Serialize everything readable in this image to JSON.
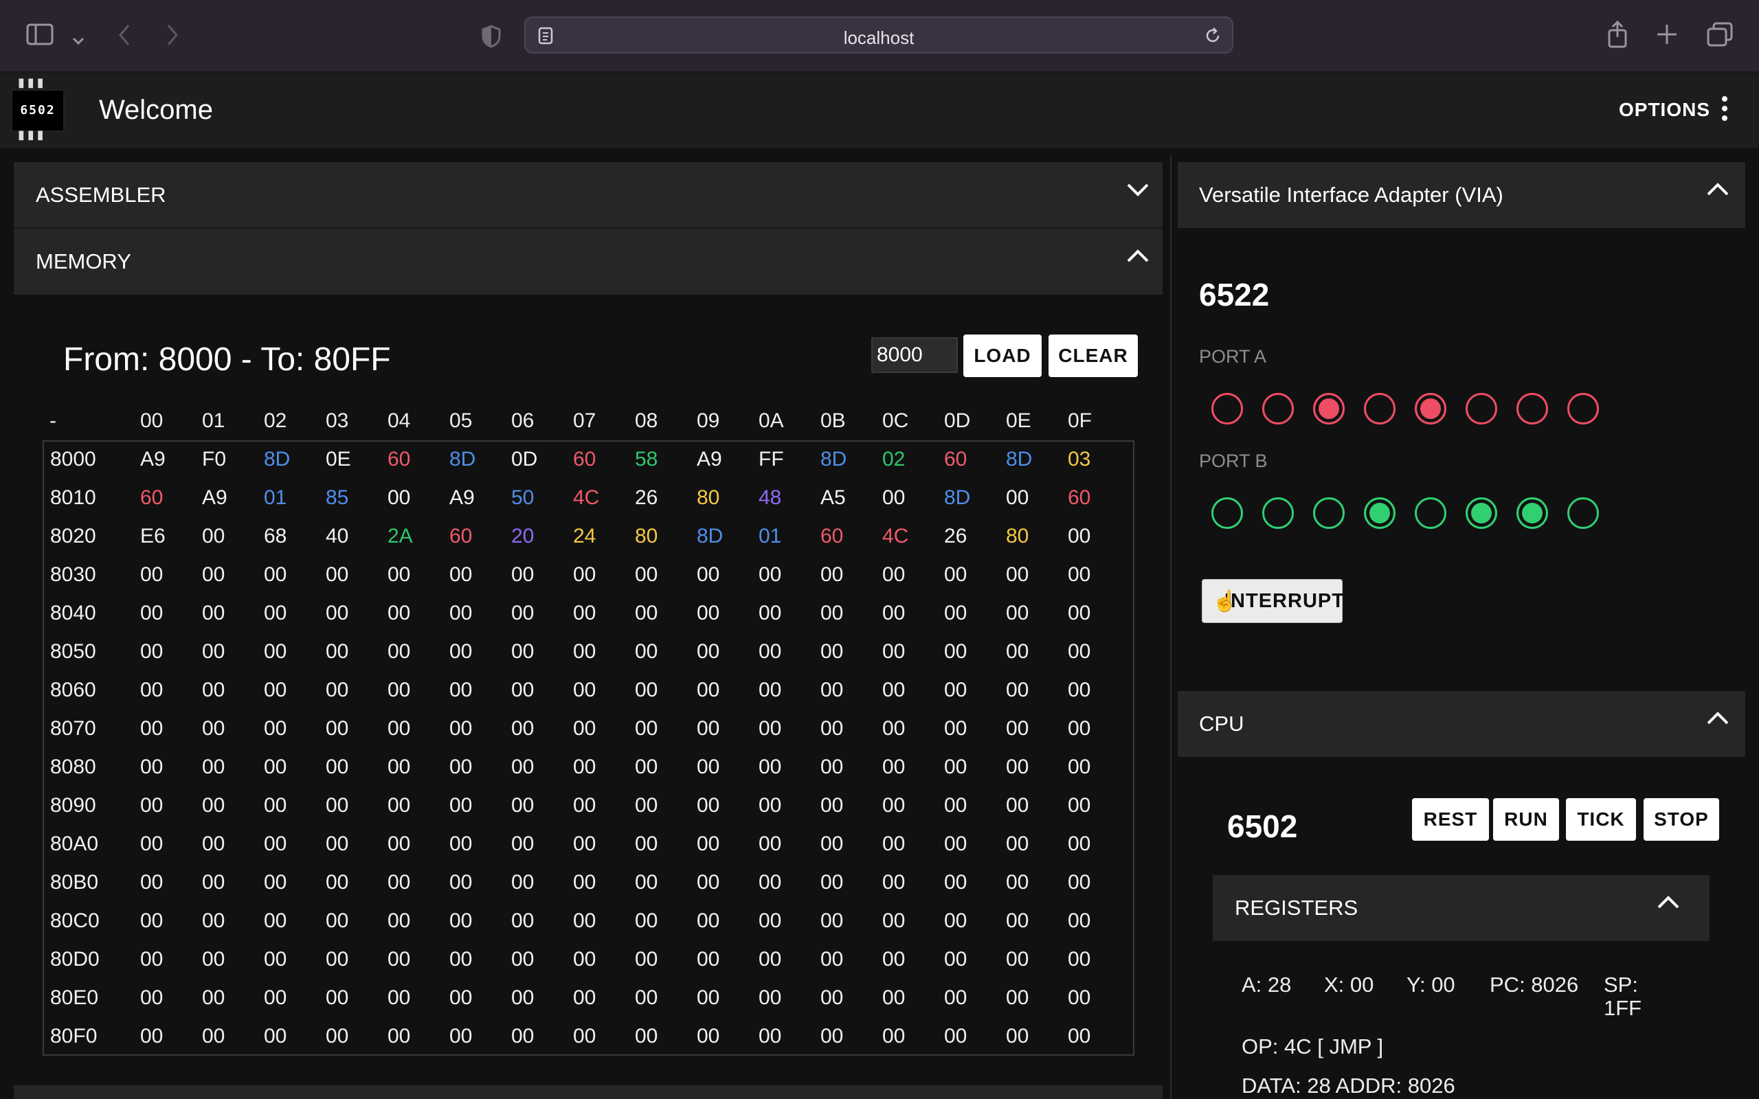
{
  "browser": {
    "url": "localhost",
    "icons": [
      "sidebar-icon",
      "chevron-down-icon",
      "back-icon",
      "forward-icon",
      "shield-icon",
      "page-icon",
      "reload-icon",
      "share-icon",
      "plus-icon",
      "tabs-icon"
    ]
  },
  "header": {
    "logo_text": "6502",
    "title": "Welcome",
    "options_label": "OPTIONS"
  },
  "left": {
    "assembler_label": "ASSEMBLER",
    "memory_label": "MEMORY",
    "range_title": "From: 8000 - To: 80FF",
    "address_value": "8000",
    "load_label": "LOAD",
    "clear_label": "CLEAR",
    "col_headers": [
      "-",
      "00",
      "01",
      "02",
      "03",
      "04",
      "05",
      "06",
      "07",
      "08",
      "09",
      "0A",
      "0B",
      "0C",
      "0D",
      "0E",
      "0F"
    ],
    "rows": [
      {
        "addr": "8000",
        "cells": [
          "A9",
          "F0",
          "8D",
          "0E",
          "60",
          "8D",
          "0D",
          "60",
          "58",
          "A9",
          "FF",
          "8D",
          "02",
          "60",
          "8D",
          "03"
        ],
        "colors": [
          "w",
          "w",
          "b",
          "w",
          "r",
          "b",
          "w",
          "r",
          "g",
          "w",
          "w",
          "b",
          "g",
          "r",
          "b",
          "y"
        ]
      },
      {
        "addr": "8010",
        "cells": [
          "60",
          "A9",
          "01",
          "85",
          "00",
          "A9",
          "50",
          "4C",
          "26",
          "80",
          "48",
          "A5",
          "00",
          "8D",
          "00",
          "60"
        ],
        "colors": [
          "r",
          "w",
          "b",
          "b",
          "w",
          "w",
          "b",
          "r",
          "w",
          "y",
          "p",
          "w",
          "w",
          "b",
          "w",
          "r"
        ]
      },
      {
        "addr": "8020",
        "cells": [
          "E6",
          "00",
          "68",
          "40",
          "2A",
          "60",
          "20",
          "24",
          "80",
          "8D",
          "01",
          "60",
          "4C",
          "26",
          "80",
          "00"
        ],
        "colors": [
          "w",
          "w",
          "w",
          "w",
          "g",
          "r",
          "p",
          "y",
          "y",
          "b",
          "b",
          "r",
          "r",
          "w",
          "y",
          "w"
        ]
      },
      {
        "addr": "8030",
        "cells": [
          "00",
          "00",
          "00",
          "00",
          "00",
          "00",
          "00",
          "00",
          "00",
          "00",
          "00",
          "00",
          "00",
          "00",
          "00",
          "00"
        ]
      },
      {
        "addr": "8040",
        "cells": [
          "00",
          "00",
          "00",
          "00",
          "00",
          "00",
          "00",
          "00",
          "00",
          "00",
          "00",
          "00",
          "00",
          "00",
          "00",
          "00"
        ]
      },
      {
        "addr": "8050",
        "cells": [
          "00",
          "00",
          "00",
          "00",
          "00",
          "00",
          "00",
          "00",
          "00",
          "00",
          "00",
          "00",
          "00",
          "00",
          "00",
          "00"
        ]
      },
      {
        "addr": "8060",
        "cells": [
          "00",
          "00",
          "00",
          "00",
          "00",
          "00",
          "00",
          "00",
          "00",
          "00",
          "00",
          "00",
          "00",
          "00",
          "00",
          "00"
        ]
      },
      {
        "addr": "8070",
        "cells": [
          "00",
          "00",
          "00",
          "00",
          "00",
          "00",
          "00",
          "00",
          "00",
          "00",
          "00",
          "00",
          "00",
          "00",
          "00",
          "00"
        ]
      },
      {
        "addr": "8080",
        "cells": [
          "00",
          "00",
          "00",
          "00",
          "00",
          "00",
          "00",
          "00",
          "00",
          "00",
          "00",
          "00",
          "00",
          "00",
          "00",
          "00"
        ]
      },
      {
        "addr": "8090",
        "cells": [
          "00",
          "00",
          "00",
          "00",
          "00",
          "00",
          "00",
          "00",
          "00",
          "00",
          "00",
          "00",
          "00",
          "00",
          "00",
          "00"
        ]
      },
      {
        "addr": "80A0",
        "cells": [
          "00",
          "00",
          "00",
          "00",
          "00",
          "00",
          "00",
          "00",
          "00",
          "00",
          "00",
          "00",
          "00",
          "00",
          "00",
          "00"
        ]
      },
      {
        "addr": "80B0",
        "cells": [
          "00",
          "00",
          "00",
          "00",
          "00",
          "00",
          "00",
          "00",
          "00",
          "00",
          "00",
          "00",
          "00",
          "00",
          "00",
          "00"
        ]
      },
      {
        "addr": "80C0",
        "cells": [
          "00",
          "00",
          "00",
          "00",
          "00",
          "00",
          "00",
          "00",
          "00",
          "00",
          "00",
          "00",
          "00",
          "00",
          "00",
          "00"
        ]
      },
      {
        "addr": "80D0",
        "cells": [
          "00",
          "00",
          "00",
          "00",
          "00",
          "00",
          "00",
          "00",
          "00",
          "00",
          "00",
          "00",
          "00",
          "00",
          "00",
          "00"
        ]
      },
      {
        "addr": "80E0",
        "cells": [
          "00",
          "00",
          "00",
          "00",
          "00",
          "00",
          "00",
          "00",
          "00",
          "00",
          "00",
          "00",
          "00",
          "00",
          "00",
          "00"
        ]
      },
      {
        "addr": "80F0",
        "cells": [
          "00",
          "00",
          "00",
          "00",
          "00",
          "00",
          "00",
          "00",
          "00",
          "00",
          "00",
          "00",
          "00",
          "00",
          "00",
          "00"
        ]
      }
    ],
    "byte_colors": {
      "w": "#f2f2f2",
      "r": "#f05a6a",
      "b": "#4f8ee8",
      "g": "#2fc76a",
      "y": "#f5c842",
      "p": "#8d6cf0"
    }
  },
  "via": {
    "section_label": "Versatile Interface Adapter (VIA)",
    "chip": "6522",
    "port_a_label": "PORT A",
    "port_a": [
      false,
      false,
      true,
      false,
      true,
      false,
      false,
      false
    ],
    "port_b_label": "PORT B",
    "port_b": [
      false,
      false,
      false,
      true,
      false,
      true,
      true,
      false
    ],
    "interrupt_label": "INTERRUPT"
  },
  "cpu": {
    "section_label": "CPU",
    "chip": "6502",
    "buttons": [
      "REST",
      "RUN",
      "TICK",
      "STOP"
    ],
    "registers_label": "REGISTERS",
    "a": "A: 28",
    "x": "X: 00",
    "y": "Y: 00",
    "pc": "PC: 8026",
    "sp_line1": "SP:",
    "sp_line2": "1FF",
    "op": "OP: 4C [ JMP ]",
    "data_addr": "DATA: 28 ADDR: 8026"
  },
  "colors": {
    "background": "#111112",
    "panel": "#262627",
    "led_red": "#ee4d63",
    "led_green": "#30d070"
  }
}
